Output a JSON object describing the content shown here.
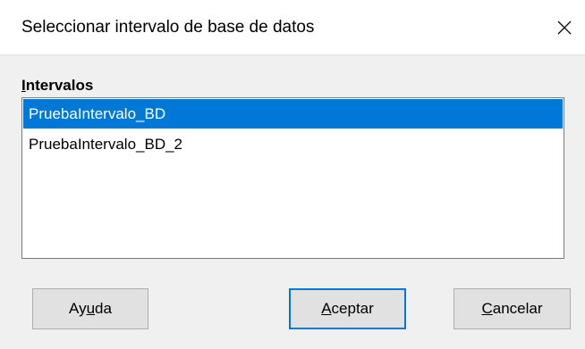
{
  "window": {
    "title": "Seleccionar intervalo de base de datos",
    "close_icon": "close-icon"
  },
  "ranges": {
    "label_pre": "I",
    "label_rest": "ntervalos",
    "items": [
      {
        "label": "PruebaIntervalo_BD",
        "selected": true
      },
      {
        "label": "PruebaIntervalo_BD_2",
        "selected": false
      }
    ]
  },
  "buttons": {
    "help": {
      "pre": "Ay",
      "mnemonic": "u",
      "post": "da"
    },
    "ok": {
      "pre": "",
      "mnemonic": "A",
      "post": "ceptar"
    },
    "cancel": {
      "pre": "",
      "mnemonic": "C",
      "post": "ancelar"
    }
  },
  "colors": {
    "selection": "#0078d7",
    "default_button_border": "#0078d7"
  }
}
